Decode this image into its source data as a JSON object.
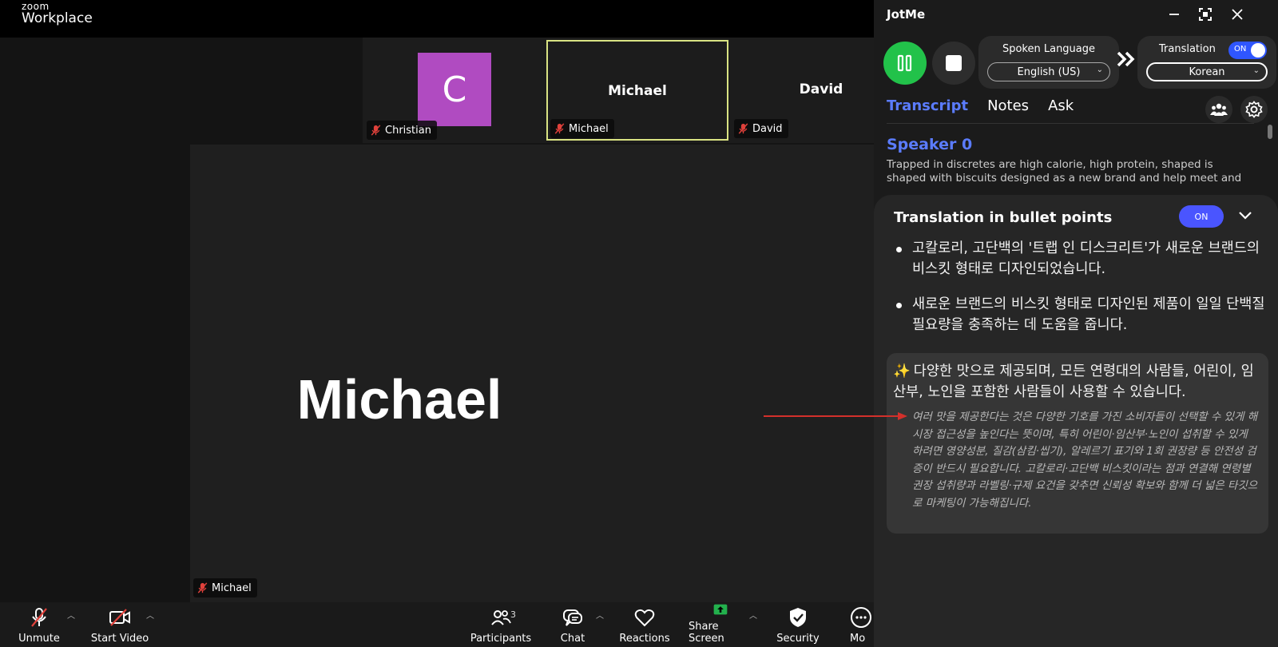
{
  "zoom": {
    "brand_small": "zoom",
    "brand_large": "Workplace",
    "participants": [
      {
        "name": "Christian",
        "initial": "C",
        "label": "Christian"
      },
      {
        "name": "Michael",
        "label": "Michael"
      },
      {
        "name": "David",
        "label": "David"
      }
    ],
    "speaker_name": "Michael",
    "speaker_tag": "Michael",
    "toolbar": {
      "unmute": "Unmute",
      "start_video": "Start Video",
      "participants": "Participants",
      "participant_count": "3",
      "chat": "Chat",
      "reactions": "Reactions",
      "share_screen": "Share Screen",
      "security": "Security",
      "more": "Mo"
    }
  },
  "jotme": {
    "title": "JotMe",
    "spoken_language_label": "Spoken Language",
    "spoken_language_value": "English (US)",
    "translation_label": "Translation",
    "translation_toggle": "ON",
    "translation_value": "Korean",
    "tabs": [
      "Transcript",
      "Notes",
      "Ask"
    ],
    "active_tab": "Transcript",
    "speaker": "Speaker 0",
    "transcript_text": "Trapped in discretes are high calorie, high protein, shaped is shaped with biscuits designed as a new brand and help meet and help meet",
    "sheet_title": "Translation in bullet points",
    "sheet_toggle": "ON",
    "bullets": [
      "고칼로리, 고단백의 '트랩 인 디스크리트'가 새로운 브랜드의 비스킷 형태로 디자인되었습니다.",
      "새로운 브랜드의 비스킷 형태로 디자인된 제품이 일일 단백질 필요량을 충족하는 데 도움을 줍니다."
    ],
    "highlight_spark": "✨",
    "highlight_text": "다양한 맛으로 제공되며, 모든 연령대의 사람들, 어린이, 임산부, 노인을 포함한 사람들이 사용할 수 있습니다.",
    "highlight_note": "여러 맛을 제공한다는 것은 다양한 기호를 가진 소비자들이 선택할 수 있게 해 시장 접근성을 높인다는 뜻이며, 특히 어린이·임산부·노인이 섭취할 수 있게 하려면 영양성분, 질감(삼킴·씹기), 알레르기 표기와 1회 권장량 등 안전성 검증이 반드시 필요합니다. 고칼로리·고단백 비스킷이라는 점과 연결해 연령별 권장 섭취량과 라벨링·규제 요건을 갖추면 신뢰성 확보와 함께 더 넓은 타깃으로 마케팅이 가능해집니다."
  },
  "colors": {
    "accent_blue": "#5b7cff",
    "record_green": "#22c24a",
    "active_border": "#d9e383",
    "avatar_purple": "#b04bc1",
    "annotation_red": "#d3302b"
  }
}
